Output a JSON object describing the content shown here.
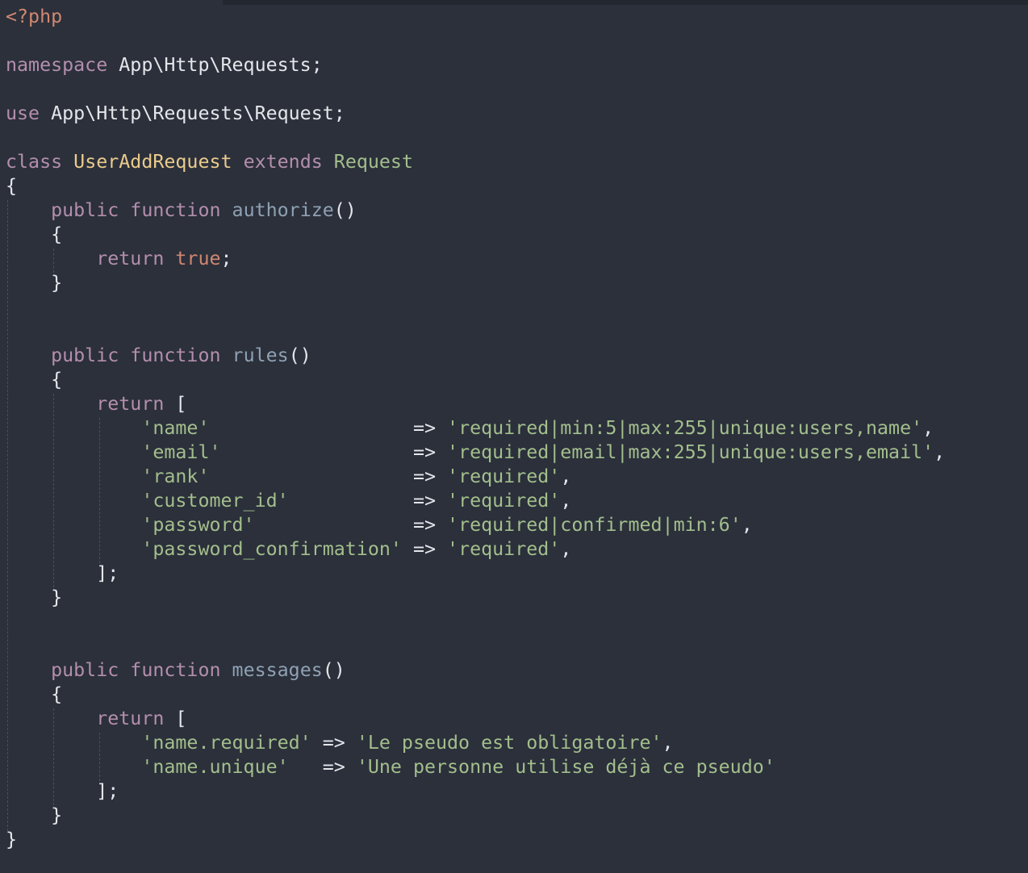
{
  "editor": {
    "background": "#2b303b",
    "colors": {
      "keyword": "#b48ead",
      "php_tag": "#d08770",
      "class_name": "#ebcb8b",
      "parent_class": "#a3be8c",
      "function_name": "#8fa1b3",
      "string": "#a3be8c",
      "constant": "#d08770",
      "plain": "#e4e6ea"
    },
    "code": {
      "php_open": "<?php",
      "namespace_kw": "namespace",
      "namespace_name": "App\\Http\\Requests;",
      "use_kw": "use",
      "use_name": "App\\Http\\Requests\\Request;",
      "class_kw": "class",
      "class_name": "UserAddRequest",
      "extends_kw": "extends",
      "parent_class": "Request",
      "public_kw": "public",
      "function_kw": "function",
      "return_kw": "return",
      "true_const": "true",
      "fn_authorize": "authorize",
      "fn_rules": "rules",
      "fn_messages": "messages",
      "rules": [
        {
          "key_spaced": "'name'                 ",
          "value": "'required|min:5|max:255|unique:users,name'"
        },
        {
          "key_spaced": "'email'                ",
          "value": "'required|email|max:255|unique:users,email'"
        },
        {
          "key_spaced": "'rank'                 ",
          "value": "'required'"
        },
        {
          "key_spaced": "'customer_id'          ",
          "value": "'required'"
        },
        {
          "key_spaced": "'password'             ",
          "value": "'required|confirmed|min:6'"
        },
        {
          "key_spaced": "'password_confirmation'",
          "value": "'required'"
        }
      ],
      "messages": [
        {
          "key_spaced": "'name.required'",
          "value": "'Le pseudo est obligatoire'",
          "trail": ","
        },
        {
          "key_spaced": "'name.unique'  ",
          "value": "'Une personne utilise déjà ce pseudo'",
          "trail": ""
        }
      ]
    }
  }
}
